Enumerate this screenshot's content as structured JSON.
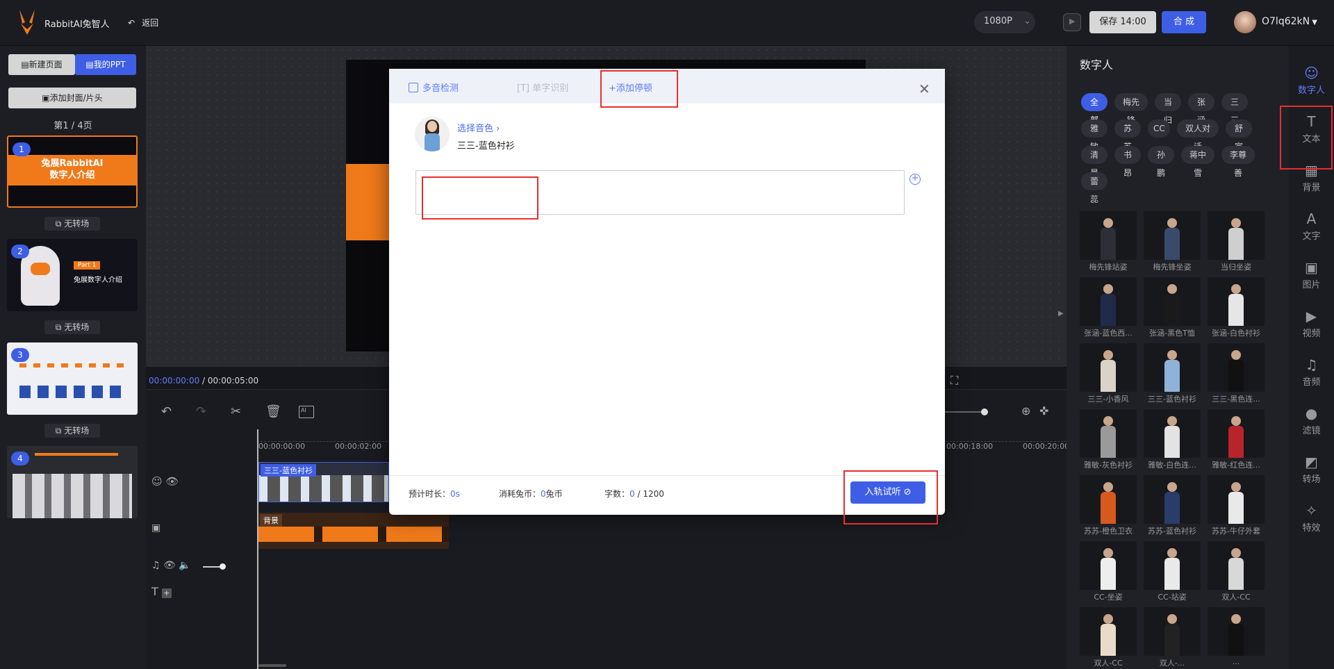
{
  "header": {
    "brand": "RabbitAI兔智人",
    "back_label": "返回",
    "resolution": "1080P",
    "save_label": "保存 14:00",
    "compose_label": "合 成",
    "username": "O7lq62kN"
  },
  "left_panel": {
    "new_page": "新建页面",
    "my_ppt": "我的PPT",
    "add_cover": "添加封面/片头",
    "page_info": "第1 / 4页",
    "slides": [
      {
        "num": "1",
        "title": "兔展RabbitAI\n数字人介绍"
      },
      {
        "num": "2",
        "title": "兔展数字人介绍",
        "part": "Part 1"
      },
      {
        "num": "3"
      },
      {
        "num": "4"
      }
    ],
    "transition_label": "无转场"
  },
  "time": {
    "current": "00:00:00:00",
    "total": "/ 00:00:05:00"
  },
  "timeline": {
    "ticks": [
      "00:00:00:00",
      "00:00:02:00",
      "00:00:18:00",
      "00:00:20:00"
    ],
    "track1_label": "三三-蓝色衬衫",
    "track2_label": "背景"
  },
  "right_panel": {
    "title": "数字人",
    "tags": [
      "全部",
      "梅先锋",
      "当归",
      "张涵",
      "三三",
      "雅敏",
      "苏苏",
      "CC",
      "双人对话",
      "舒宣",
      "清晨",
      "书昂",
      "孙鹏",
      "蒋中雪",
      "李尊善",
      "蕾蕊"
    ],
    "persons": [
      {
        "name": "梅先锋站姿",
        "color": "#2c2f36"
      },
      {
        "name": "梅先锋坐姿",
        "color": "#3a4a6a"
      },
      {
        "name": "当归坐姿",
        "color": "#cfcfcf"
      },
      {
        "name": "张涵-蓝色西...",
        "color": "#1f2b48"
      },
      {
        "name": "张涵-黑色T恤",
        "color": "#1a1a1a"
      },
      {
        "name": "张涵-白色衬衫",
        "color": "#e6e6e6"
      },
      {
        "name": "三三-小香风",
        "color": "#d9d3c8"
      },
      {
        "name": "三三-蓝色衬衫",
        "color": "#8fb2d8"
      },
      {
        "name": "三三-黑色连...",
        "color": "#111"
      },
      {
        "name": "雅敏-灰色衬衫",
        "color": "#9a9a9a"
      },
      {
        "name": "雅敏-白色连...",
        "color": "#e3e3e3"
      },
      {
        "name": "雅敏-红色连...",
        "color": "#b8242b"
      },
      {
        "name": "苏苏-橙色卫衣",
        "color": "#d65a1e"
      },
      {
        "name": "苏苏-蓝色衬衫",
        "color": "#2a3d6a"
      },
      {
        "name": "苏苏-牛仔外套",
        "color": "#e9e9e9"
      },
      {
        "name": "CC-坐姿",
        "color": "#eeeeee"
      },
      {
        "name": "CC-站姿",
        "color": "#e9e9e9"
      },
      {
        "name": "双人-CC",
        "color": "#d8d8d8"
      },
      {
        "name": "双人-CC",
        "color": "#e8dcc8"
      },
      {
        "name": "双人-...",
        "color": "#222"
      },
      {
        "name": "...",
        "color": "#111"
      }
    ]
  },
  "rail": [
    {
      "label": "数字人",
      "icon": "digital-human-icon",
      "glyph": "☺"
    },
    {
      "label": "文本",
      "icon": "text-icon",
      "glyph": "T"
    },
    {
      "label": "背景",
      "icon": "background-icon",
      "glyph": "▦"
    },
    {
      "label": "文字",
      "icon": "font-icon",
      "glyph": "A"
    },
    {
      "label": "图片",
      "icon": "image-icon",
      "glyph": "▣"
    },
    {
      "label": "视频",
      "icon": "video-icon",
      "glyph": "▶"
    },
    {
      "label": "音频",
      "icon": "headphone-icon",
      "glyph": "♫"
    },
    {
      "label": "滤镜",
      "icon": "filter-icon",
      "glyph": "●"
    },
    {
      "label": "转场",
      "icon": "transition-icon",
      "glyph": "◩"
    },
    {
      "label": "特效",
      "icon": "effect-icon",
      "glyph": "✧"
    }
  ],
  "modal": {
    "tab_polyphone": "多音检测",
    "tab_single": "单字识别",
    "tab_pause": "+添加停顿",
    "choose_voice": "选择音色 ›",
    "voice_name": "三三-蓝色衬衫",
    "textarea_value": "",
    "est_duration_label": "预计时长：",
    "est_duration_value": "0",
    "est_duration_unit": "s",
    "cost_label": "消耗兔币：",
    "cost_value": "0",
    "cost_unit": "兔币",
    "chars_label": "字数：",
    "chars_value": "0",
    "chars_max": "/ 1200",
    "submit_label": "入轨试听 ⊘"
  },
  "colors": {
    "accent": "#3e5ee6",
    "highlight": "#e52e2e",
    "orange": "#f07a1a"
  }
}
